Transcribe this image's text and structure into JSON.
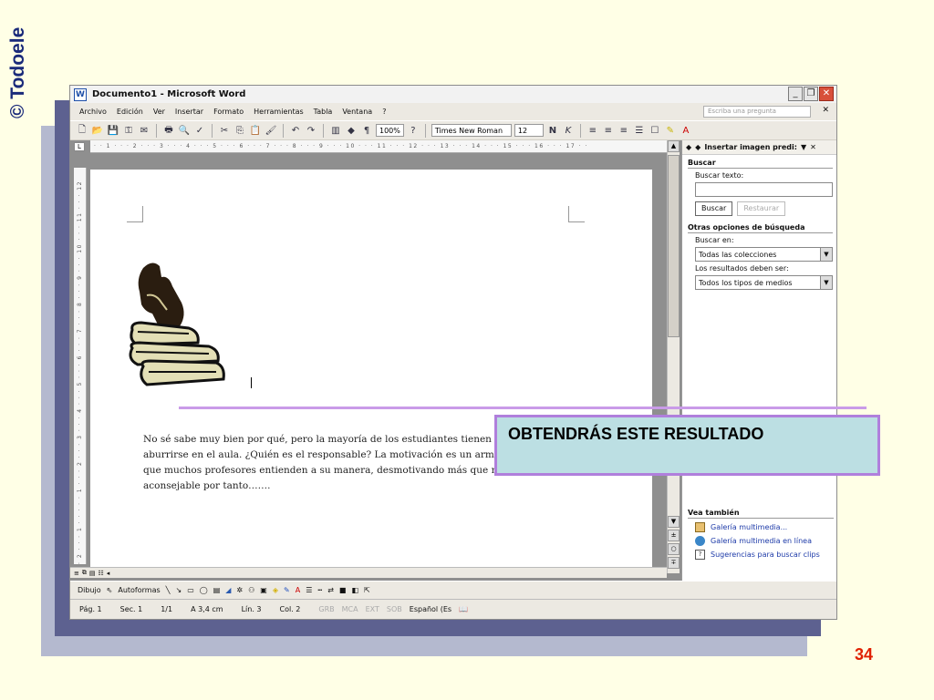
{
  "slide": {
    "brand": "© Todoele",
    "page_number": "34",
    "callout_text": "OBTENDRÁS ESTE RESULTADO"
  },
  "window": {
    "title": "Documento1 - Microsoft Word",
    "menu": [
      "Archivo",
      "Edición",
      "Ver",
      "Insertar",
      "Formato",
      "Herramientas",
      "Tabla",
      "Ventana",
      "?"
    ],
    "ask_placeholder": "Escriba una pregunta",
    "zoom": "100%",
    "font_name": "Times New Roman",
    "font_size": "12"
  },
  "rulers": {
    "horizontal": "· · 1 · · · 2 · · · 3 · · · 4 · · · 5 · · · 6 · · · 7 · · · 8 · · · 9 · · · 10 · · · 11 · · · 12 · · · 13 · · · 14 · · · 15 · · · 16 · · · 17 · ·",
    "vertical": "· 2 · · · 1 · · · · · 1 · · · 2 · · · 3 · · · 4 · · · 5 · · · 6 · · · 7 · · · 8 · · · 9 · · · 10 · · · 11 · · · 12"
  },
  "document": {
    "paragraph": "No sé sabe muy bien por qué, pero la mayoría de los estudiantes tienen te aburrirse en el aula. ¿Quién es el responsable? La motivación es un arma que muchos profesores entienden a su manera, desmotivando más que mo aconsejable por tanto……."
  },
  "taskpane": {
    "title": "Insertar imagen predi:",
    "search_section": "Buscar",
    "search_text_label": "Buscar texto:",
    "search_text_value": "",
    "search_button": "Buscar",
    "restore_button": "Restaurar",
    "other_options": "Otras opciones de búsqueda",
    "search_in_label": "Buscar en:",
    "search_in_value": "Todas las colecciones",
    "results_label": "Los resultados deben ser:",
    "results_value": "Todos los tipos de medios",
    "see_also": "Vea también",
    "links": [
      "Galería multimedia...",
      "Galería multimedia en línea",
      "Sugerencias para buscar clips"
    ]
  },
  "drawbar": {
    "draw": "Dibujo",
    "autoshapes": "Autoformas"
  },
  "status": {
    "page": "Pág. 1",
    "section": "Sec. 1",
    "pages": "1/1",
    "at": "A 3,4 cm",
    "line": "Lín. 3",
    "col": "Col. 2",
    "grb": "GRB",
    "mca": "MCA",
    "ext": "EXT",
    "sob": "SOB",
    "lang": "Español (Es"
  }
}
